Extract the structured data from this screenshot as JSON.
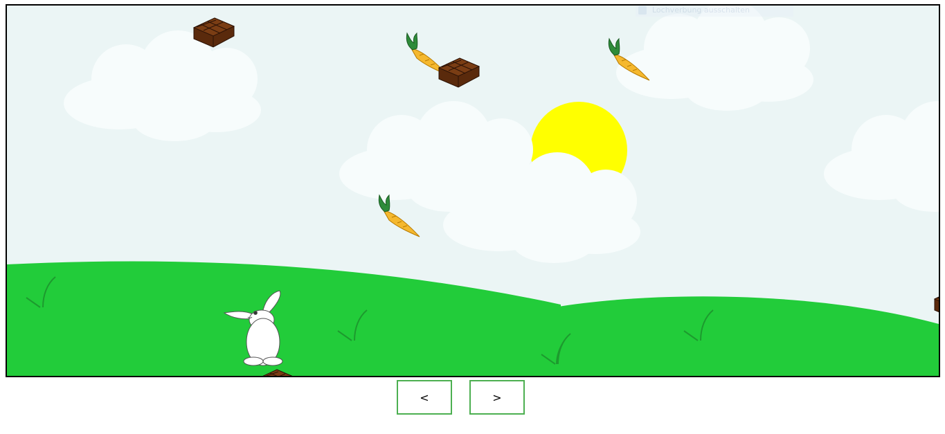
{
  "overlay": {
    "label": "Lochverbung ausschalten",
    "icon": "info-icon"
  },
  "navigation": {
    "prev_label": "<",
    "next_label": ">"
  },
  "colors": {
    "sky": "#ebf5f5",
    "cloud": "#f7fcfc",
    "sun": "#ffff00",
    "grass": "#22cc3a",
    "grass_blade": "#1d9a2e",
    "carrot": "#f5b82e",
    "carrot_leaf": "#2e8b3a",
    "chocolate": "#6b3410",
    "button_border": "#4caf50"
  },
  "scene": {
    "player": "rabbit-icon",
    "falling_items": [
      "chocolate-bar-icon",
      "carrot-icon",
      "chocolate-bar-icon",
      "carrot-icon",
      "carrot-icon",
      "chocolate-bar-icon",
      "chocolate-bar-icon"
    ]
  }
}
